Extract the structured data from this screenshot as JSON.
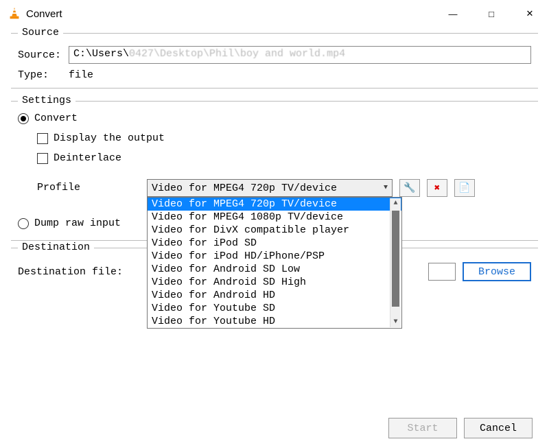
{
  "window": {
    "title": "Convert"
  },
  "source": {
    "legend": "Source",
    "label_source": "Source:",
    "path_visible": "C:\\Users\\",
    "path_blurred": "0427\\Desktop\\Phil\\boy and world.mp4",
    "label_type": "Type:",
    "type_value": "file"
  },
  "settings": {
    "legend": "Settings",
    "radio_convert": "Convert",
    "check_display": "Display the output",
    "check_deinterlace": "Deinterlace",
    "profile_label": "Profile",
    "profile_selected": "Video for MPEG4 720p TV/device",
    "profile_options": [
      "Video for MPEG4 720p TV/device",
      "Video for MPEG4 1080p TV/device",
      "Video for DivX compatible player",
      "Video for iPod SD",
      "Video for iPod HD/iPhone/PSP",
      "Video for Android SD Low",
      "Video for Android SD High",
      "Video for Android HD",
      "Video for Youtube SD",
      "Video for Youtube HD"
    ],
    "radio_dump": "Dump raw input"
  },
  "destination": {
    "legend": "Destination",
    "label": "Destination file:",
    "browse": "Browse"
  },
  "buttons": {
    "start": "Start",
    "cancel": "Cancel"
  }
}
